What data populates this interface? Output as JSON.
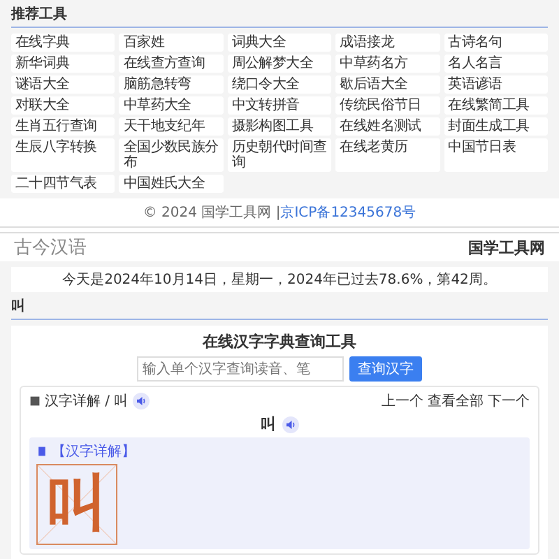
{
  "recommended": {
    "title": "推荐工具",
    "tools": [
      "在线字典",
      "百家姓",
      "词典大全",
      "成语接龙",
      "古诗名句",
      "新华词典",
      "在线查方查询",
      "周公解梦大全",
      "中草药名方",
      "名人名言",
      "谜语大全",
      "脑筋急转弯",
      "绕口令大全",
      "歇后语大全",
      "英语谚语",
      "对联大全",
      "中草药大全",
      "中文转拼音",
      "传统民俗节日",
      "在线繁简工具",
      "生肖五行查询",
      "天干地支纪年",
      "摄影构图工具",
      "在线姓名测试",
      "封面生成工具",
      "生辰八字转换",
      "全国少数民族分布",
      "历史朝代时间查询",
      "在线老黄历",
      "中国节日表",
      "二十四节气表",
      "中国姓氏大全"
    ]
  },
  "footer": {
    "copyright": "© 2024 国学工具网 |",
    "icp": "京ICP备12345678号"
  },
  "header": {
    "logo": "古今汉语",
    "site_name": "国学工具网"
  },
  "date_banner": "今天是2024年10月14日，星期一，2024年已过去78.6%，第42周。",
  "section": {
    "title": "叫"
  },
  "tool": {
    "title": "在线汉字字典查询工具",
    "placeholder": "输入单个汉字查询读音、笔",
    "button": "查询汉字",
    "detail": {
      "breadcrumb": "汉字详解 / 叫",
      "nav": [
        "上一个",
        "查看全部",
        "下一个"
      ],
      "character": "叫",
      "panel_title": "【汉字详解】",
      "big_character": "叫"
    }
  }
}
